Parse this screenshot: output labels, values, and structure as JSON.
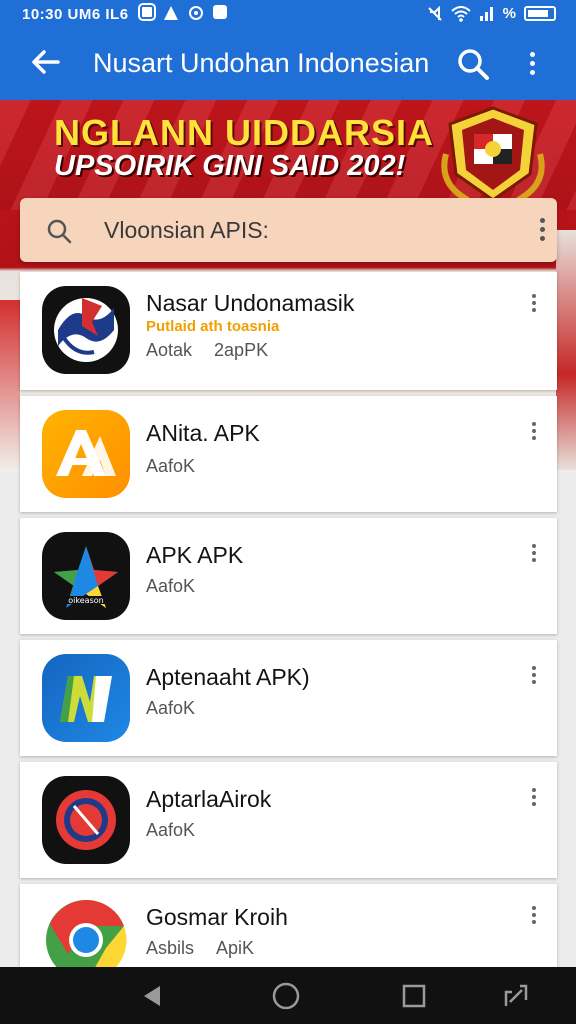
{
  "status_bar": {
    "time": "10:30 UM6 IL6",
    "signal_text": "%",
    "icons": [
      "image-icon",
      "alert-icon",
      "info-icon",
      "app-icon",
      "mute-icon",
      "wifi-icon",
      "signal-icon",
      "battery-icon"
    ]
  },
  "app_bar": {
    "title": "Nusart Undohan Indonesian",
    "icons": [
      "back-arrow-icon",
      "search-icon",
      "more-vert-icon"
    ]
  },
  "banner": {
    "line1": "NGLANN UIDDARSIA",
    "line2": "UPSOIRIK GINI SAID 202!",
    "colors": {
      "red": "#c8161d",
      "yellow": "#ffe23a"
    }
  },
  "search": {
    "placeholder": "Vloonsian APIS:"
  },
  "apps": [
    {
      "name": "Nasar Undonamasik",
      "subtitle": "Putlaid ath toasnia",
      "meta1": "Aotak",
      "meta2": "2apPK",
      "icon": "flag-globe-icon"
    },
    {
      "name": "ANita. APK",
      "meta1": "AafoK",
      "icon": "letter-a-icon"
    },
    {
      "name": "APK APK",
      "meta1": "AafoK",
      "icon": "star-logo-icon"
    },
    {
      "name": "Aptenaaht APK)",
      "meta1": "AafoK",
      "icon": "letter-n-icon"
    },
    {
      "name": "AptarlaAirok",
      "meta1": "AafoK",
      "icon": "red-circle-icon"
    },
    {
      "name": "Gosmar Kroih",
      "meta1": "Asbils",
      "meta2": "ApiK",
      "icon": "chrome-icon"
    }
  ],
  "nav_bar": {
    "icons": [
      "back-triangle-icon",
      "home-circle-icon",
      "recents-square-icon",
      "screenshot-icon"
    ]
  },
  "colors": {
    "primary": "#1f6fd6",
    "search_bg": "#f7d5bd",
    "nav": "#111111"
  }
}
